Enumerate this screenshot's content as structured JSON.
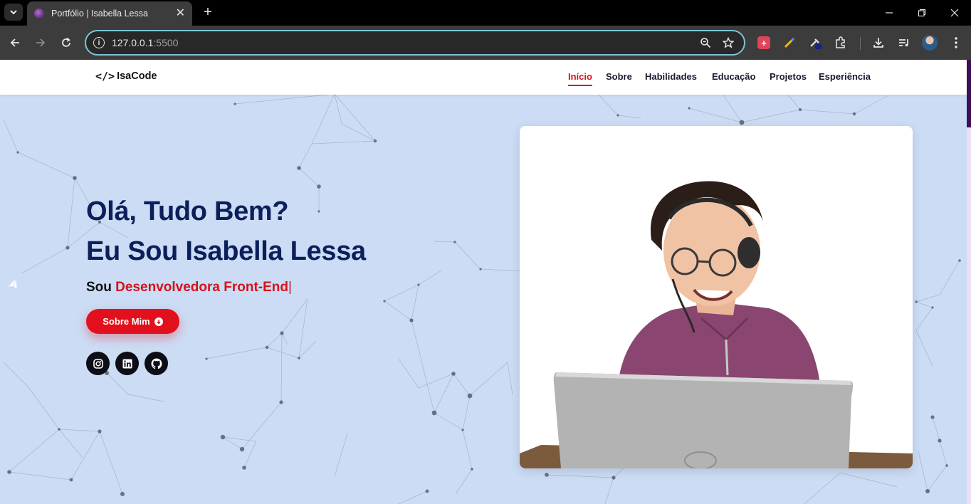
{
  "browser": {
    "tab_title": "Portfólio | Isabella Lessa",
    "url_host": "127.0.0.1",
    "url_port": ":5500",
    "new_tab": "+",
    "close_tab": "✕"
  },
  "header": {
    "logo_icon": "</>",
    "logo_text": "IsaCode",
    "nav": [
      "Início",
      "Sobre",
      "Habilidades",
      "Educação",
      "Projetos",
      "Esperiência"
    ],
    "active_nav": "Início"
  },
  "hero": {
    "greeting": "Olá, Tudo Bem?",
    "name_line": "Eu Sou Isabella Lessa",
    "sub_prefix": "Sou",
    "sub_role": "Desenvolvedora Front-End",
    "sub_caret": "|",
    "cta_label": "Sobre Mim"
  },
  "social": {
    "icons": [
      "instagram-icon",
      "linkedin-icon",
      "github-icon"
    ]
  },
  "colors": {
    "accent": "#d5121b",
    "title": "#0c1f5b",
    "background": "#cbdcf4"
  }
}
